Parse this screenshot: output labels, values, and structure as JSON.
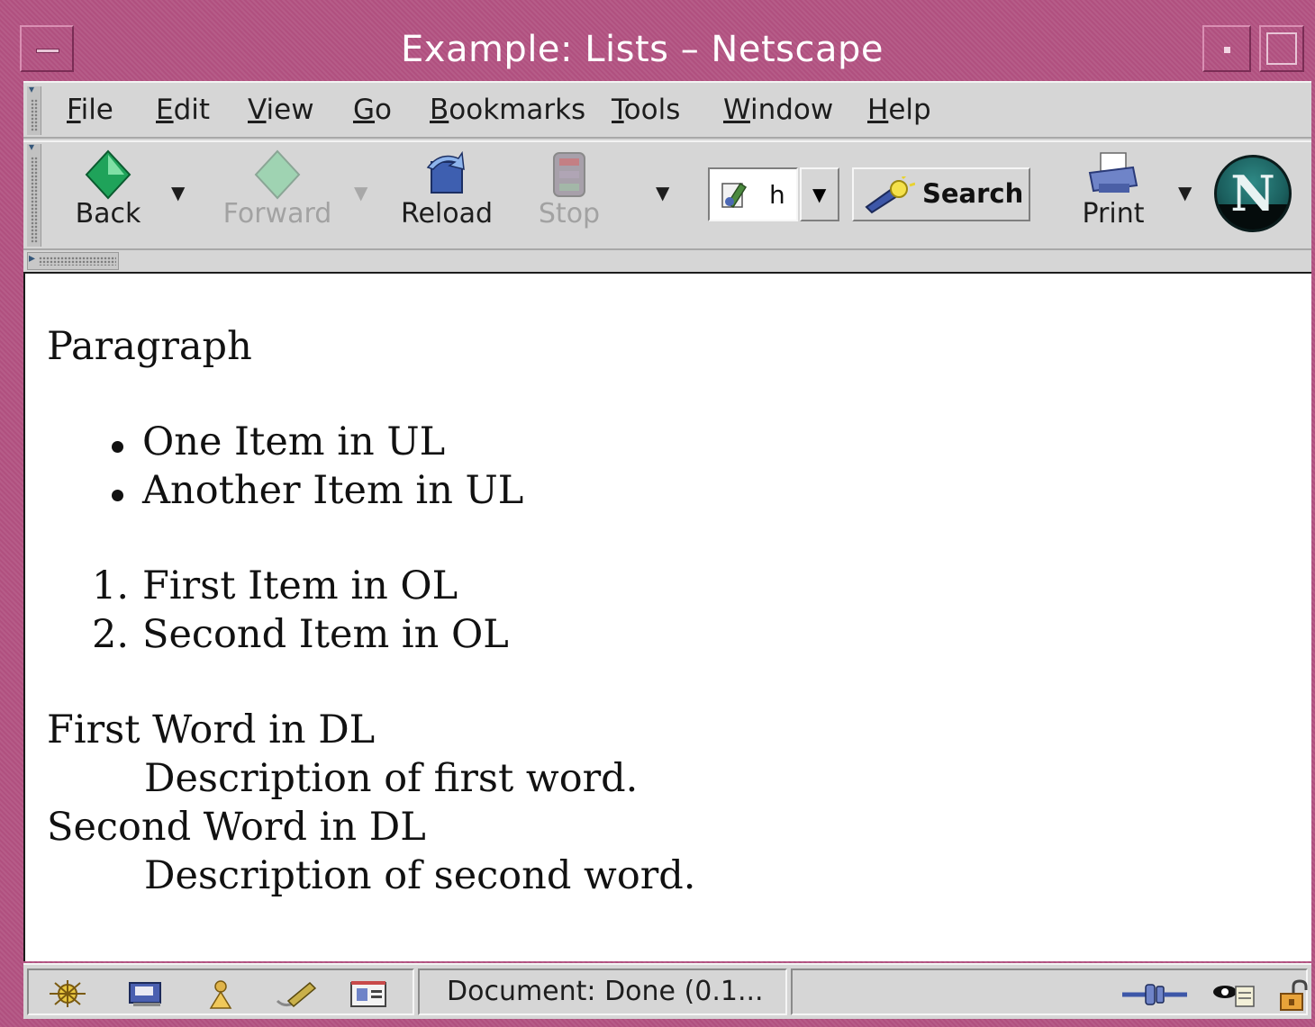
{
  "window": {
    "title": "Example: Lists – Netscape"
  },
  "menubar": {
    "items": [
      {
        "accel": "F",
        "rest": "ile"
      },
      {
        "accel": "E",
        "rest": "dit"
      },
      {
        "accel": "V",
        "rest": "iew"
      },
      {
        "accel": "G",
        "rest": "o"
      },
      {
        "accel": "B",
        "rest": "ookmarks"
      },
      {
        "accel": "T",
        "rest": "ools"
      },
      {
        "accel": "W",
        "rest": "indow"
      },
      {
        "accel": "H",
        "rest": "elp"
      }
    ]
  },
  "toolbar": {
    "back_label": "Back",
    "forward_label": "Forward",
    "reload_label": "Reload",
    "stop_label": "Stop",
    "url_value": "h",
    "search_label": "Search",
    "print_label": "Print",
    "logo_letter": "N"
  },
  "content": {
    "paragraph": "Paragraph",
    "ul_items": [
      "One Item in UL",
      "Another Item in UL"
    ],
    "ol_numbers": [
      "1.",
      "2."
    ],
    "ol_items": [
      "First Item in OL",
      "Second Item in OL"
    ],
    "dl": [
      {
        "term": "First Word in DL",
        "desc": "Description of first word."
      },
      {
        "term": "Second Word in DL",
        "desc": "Description of second word."
      }
    ]
  },
  "statusbar": {
    "text": "Document: Done (0.1..."
  },
  "colors": {
    "title_bar": "#b0507f",
    "chrome": "#d6d6d6",
    "content_bg": "#ffffff"
  }
}
